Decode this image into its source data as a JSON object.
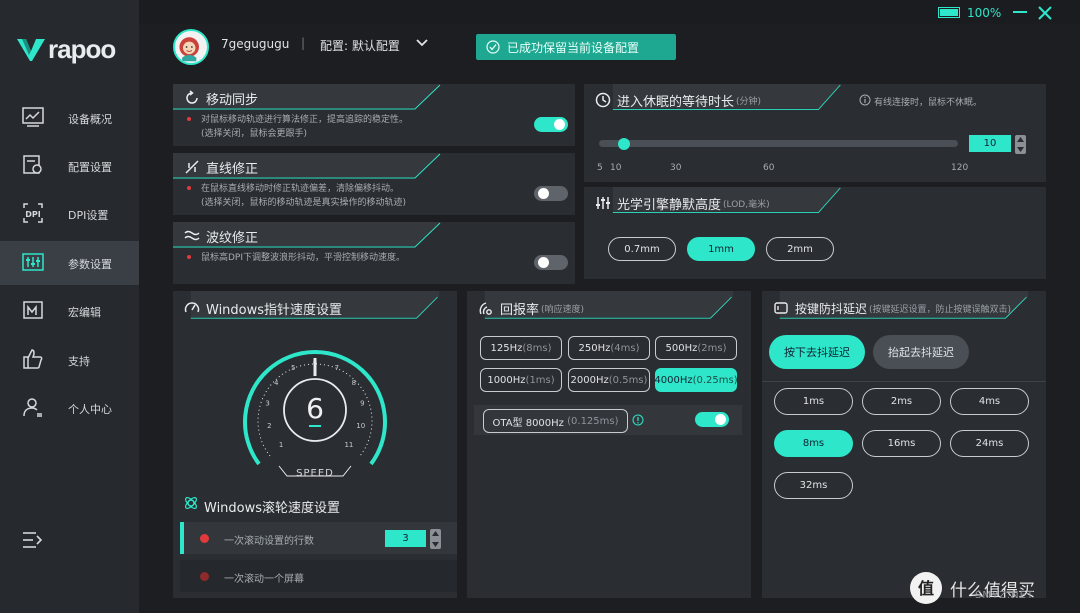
{
  "brand": {
    "logo_text": "rapoo",
    "accent": "#2ee6c9"
  },
  "window": {
    "battery_text": "100%"
  },
  "sidebar": {
    "items": [
      {
        "label": "设备概况",
        "icon": "chart-icon"
      },
      {
        "label": "配置设置",
        "icon": "config-icon"
      },
      {
        "label": "DPI设置",
        "icon": "dpi-icon"
      },
      {
        "label": "参数设置",
        "icon": "sliders-icon",
        "active": true
      },
      {
        "label": "宏编辑",
        "icon": "macro-icon"
      },
      {
        "label": "支持",
        "icon": "thumbs-up-icon"
      },
      {
        "label": "个人中心",
        "icon": "user-icon"
      }
    ]
  },
  "header": {
    "username": "7gegugugu",
    "separator": "|",
    "profile": "配置: 默认配置",
    "toast": "已成功保留当前设备配置"
  },
  "motion_sync": {
    "title": "移动同步",
    "desc1": "对鼠标移动轨迹进行算法修正，提高追踪的稳定性。",
    "desc2": "(选择关闭，鼠标会更跟手)",
    "enabled": true
  },
  "straight_line": {
    "title": "直线修正",
    "desc1": "在鼠标直线移动时修正轨迹偏差，清除偏移抖动。",
    "desc2": "(选择关闭，鼠标的移动轨迹是真实操作的移动轨迹)",
    "enabled": false
  },
  "ripple": {
    "title": "波纹修正",
    "desc1": "鼠标高DPI下调整波浪形抖动，平滑控制移动速度。",
    "enabled": false
  },
  "sleep": {
    "title": "进入休眠的等待时长",
    "unit": "(分钟)",
    "note": "有线连接时，鼠标不休眠。",
    "value": "10",
    "ticks": [
      "5",
      "10",
      "30",
      "60",
      "120"
    ],
    "min": 5,
    "max": 120,
    "current": 10
  },
  "lod": {
    "title": "光学引擎静默高度",
    "unit": "(LOD,毫米)",
    "options": [
      "0.7mm",
      "1mm",
      "2mm"
    ],
    "selected": "1mm"
  },
  "pointer_speed": {
    "title": "Windows指针速度设置",
    "value": "6",
    "label": "SPEED",
    "dial_numbers": [
      "1",
      "2",
      "3",
      "4",
      "5",
      "6",
      "7",
      "8",
      "9",
      "10",
      "11"
    ]
  },
  "scroll": {
    "title": "Windows滚轮速度设置",
    "row1_label": "一次滚动设置的行数",
    "row1_value": "3",
    "row2_label": "一次滚动一个屏幕"
  },
  "polling": {
    "title": "回报率",
    "sub": "(响应速度)",
    "options": [
      {
        "main": "125Hz",
        "dim": "(8ms)"
      },
      {
        "main": "250Hz",
        "dim": "(4ms)"
      },
      {
        "main": "500Hz",
        "dim": "(2ms)"
      },
      {
        "main": "1000Hz",
        "dim": "(1ms)"
      },
      {
        "main": "2000Hz",
        "dim": "(0.5ms)"
      },
      {
        "main": "4000Hz",
        "dim": "(0.25ms)",
        "selected": true
      }
    ],
    "ota_main": "OTA型 8000Hz",
    "ota_dim": "(0.125ms)",
    "ota_enabled": true
  },
  "debounce": {
    "title": "按键防抖延迟",
    "sub": "(按键延迟设置，防止按键误触双击)",
    "press_label": "按下去抖延迟",
    "release_label": "抬起去抖延迟",
    "options": [
      "1ms",
      "2ms",
      "4ms",
      "8ms",
      "16ms",
      "24ms",
      "32ms"
    ],
    "selected": "8ms"
  },
  "watermark": {
    "text": "什么值得买",
    "url": "SMYZ.NET"
  }
}
